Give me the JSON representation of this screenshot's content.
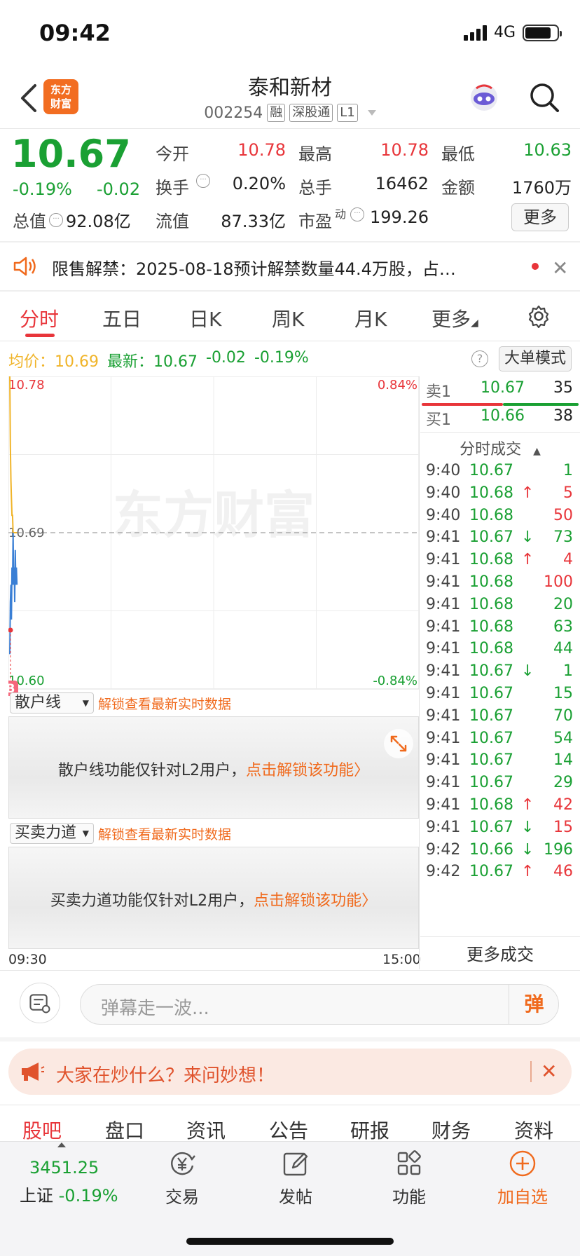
{
  "status": {
    "time": "09:42",
    "network": "4G"
  },
  "header": {
    "logo_text": "东方财富",
    "stock_name": "泰和新材",
    "stock_code": "002254",
    "tags": [
      "融",
      "深股通",
      "L1"
    ]
  },
  "quote": {
    "price": "10.67",
    "change_pct": "-0.19%",
    "change_val": "-0.02",
    "total_mv_label": "总值",
    "total_mv": "92.08亿",
    "float_mv_label": "流值",
    "float_mv": "87.33亿",
    "pe_label": "市盈",
    "pe_sup": "动",
    "pe": "199.26",
    "open_label": "今开",
    "open": "10.78",
    "high_label": "最高",
    "high": "10.78",
    "low_label": "最低",
    "low": "10.63",
    "turnover_label": "换手",
    "turnover": "0.20%",
    "volume_label": "总手",
    "volume": "16462",
    "amount_label": "金额",
    "amount": "1760万",
    "more_label": "更多"
  },
  "notice": {
    "text": "限售解禁：2025-08-18预计解禁数量44.4万股，占…"
  },
  "tabs": [
    "分时",
    "五日",
    "日K",
    "周K",
    "月K",
    "更多"
  ],
  "info_line": {
    "avg_label": "均价：",
    "avg": "10.69",
    "latest_label": "最新：",
    "latest": "10.67",
    "chg": "-0.02",
    "pct": "-0.19%",
    "big_order_label": "大单模式"
  },
  "chart_data": {
    "type": "line",
    "ylim": [
      10.6,
      10.78
    ],
    "y_tick_left_top": "10.78",
    "y_tick_left_mid": "10.69",
    "y_tick_left_bottom": "10.60",
    "y_tick_right_top": "0.84%",
    "y_tick_right_bottom": "-0.84%",
    "x_start": "09:30",
    "x_end": "15:00",
    "watermark": "东方财富",
    "series": [
      {
        "values": [
          10.62,
          10.65,
          10.66,
          10.64,
          10.67,
          10.66,
          10.69,
          10.66,
          10.67,
          10.65,
          10.68,
          10.66,
          10.67,
          10.66
        ]
      },
      {
        "values": [
          10.78,
          10.74,
          10.72,
          10.71,
          10.7,
          10.7,
          10.69,
          10.69,
          10.69,
          10.69,
          10.69,
          10.69,
          10.69,
          10.69
        ]
      }
    ]
  },
  "order_book": {
    "sell1_label": "卖1",
    "sell1_price": "10.67",
    "sell1_vol": "35",
    "buy1_label": "买1",
    "buy1_price": "10.66",
    "buy1_vol": "38",
    "trades_title": "分时成交",
    "more_trades": "更多成交",
    "trades": [
      {
        "time": "9:40",
        "price": "10.67",
        "arrow": "",
        "vol": "1",
        "vol_color": "green"
      },
      {
        "time": "9:40",
        "price": "10.68",
        "arrow": "↑",
        "vol": "5",
        "vol_color": "red"
      },
      {
        "time": "9:40",
        "price": "10.68",
        "arrow": "",
        "vol": "50",
        "vol_color": "red"
      },
      {
        "time": "9:41",
        "price": "10.67",
        "arrow": "↓",
        "vol": "73",
        "vol_color": "green"
      },
      {
        "time": "9:41",
        "price": "10.68",
        "arrow": "↑",
        "vol": "4",
        "vol_color": "red"
      },
      {
        "time": "9:41",
        "price": "10.68",
        "arrow": "",
        "vol": "100",
        "vol_color": "red"
      },
      {
        "time": "9:41",
        "price": "10.68",
        "arrow": "",
        "vol": "20",
        "vol_color": "green"
      },
      {
        "time": "9:41",
        "price": "10.68",
        "arrow": "",
        "vol": "63",
        "vol_color": "green"
      },
      {
        "time": "9:41",
        "price": "10.68",
        "arrow": "",
        "vol": "44",
        "vol_color": "green"
      },
      {
        "time": "9:41",
        "price": "10.67",
        "arrow": "↓",
        "vol": "1",
        "vol_color": "green"
      },
      {
        "time": "9:41",
        "price": "10.67",
        "arrow": "",
        "vol": "15",
        "vol_color": "green"
      },
      {
        "time": "9:41",
        "price": "10.67",
        "arrow": "",
        "vol": "70",
        "vol_color": "green"
      },
      {
        "time": "9:41",
        "price": "10.67",
        "arrow": "",
        "vol": "54",
        "vol_color": "green"
      },
      {
        "time": "9:41",
        "price": "10.67",
        "arrow": "",
        "vol": "14",
        "vol_color": "green"
      },
      {
        "time": "9:41",
        "price": "10.67",
        "arrow": "",
        "vol": "29",
        "vol_color": "green"
      },
      {
        "time": "9:41",
        "price": "10.68",
        "arrow": "↑",
        "vol": "42",
        "vol_color": "red"
      },
      {
        "time": "9:41",
        "price": "10.67",
        "arrow": "↓",
        "vol": "15",
        "vol_color": "red"
      },
      {
        "time": "9:42",
        "price": "10.66",
        "arrow": "↓",
        "vol": "196",
        "vol_color": "green"
      },
      {
        "time": "9:42",
        "price": "10.67",
        "arrow": "↑",
        "vol": "46",
        "vol_color": "red"
      }
    ]
  },
  "indicators": {
    "retail_select": "散户线",
    "retail_unlock": "解锁查看最新实时数据",
    "retail_lock_text": "散户线功能仅针对L2用户，",
    "retail_lock_link": "点击解锁该功能",
    "force_select": "买卖力道",
    "force_unlock": "解锁查看最新实时数据",
    "force_lock_text": "买卖力道功能仅针对L2用户，",
    "force_lock_link": "点击解锁该功能",
    "b_marker": "B"
  },
  "comment": {
    "placeholder": "弹幕走一波...",
    "button": "弹"
  },
  "promo": {
    "text": "大家在炒什么？来问妙想！"
  },
  "bottom_tabs": [
    "股吧",
    "盘口",
    "资讯",
    "公告",
    "研报",
    "财务",
    "资料"
  ],
  "bottom_bar": {
    "index_value": "3451.25",
    "index_name": "上证",
    "index_pct": "-0.19%",
    "items": [
      "交易",
      "发帖",
      "功能",
      "加自选"
    ]
  },
  "colors": {
    "up": "#e8353a",
    "down": "#1aa033",
    "accent": "#f06a1d",
    "price_line": "#3a7fd5",
    "avg_line": "#f0b429"
  }
}
